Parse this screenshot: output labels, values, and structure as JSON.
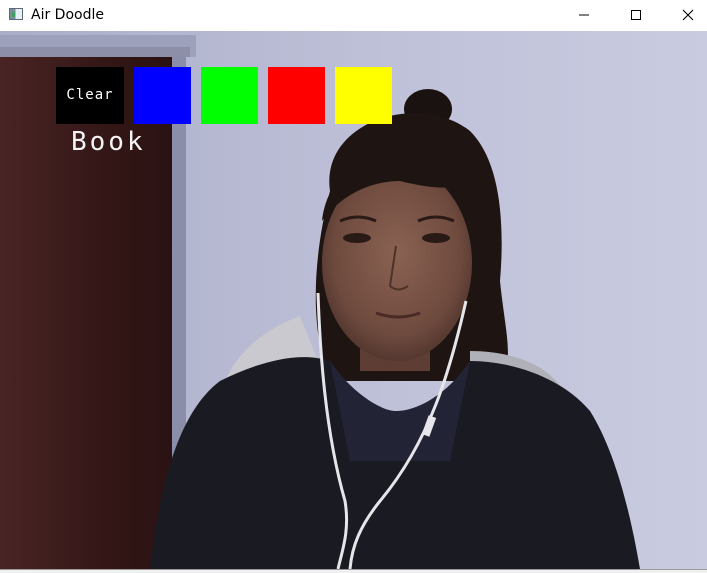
{
  "window": {
    "title": "Air Doodle",
    "icon": "app-window-icon"
  },
  "window_controls": {
    "minimize_icon": "minimize-icon",
    "maximize_icon": "maximize-icon",
    "close_icon": "close-icon"
  },
  "toolbar": {
    "clear_label": "Clear",
    "colors": [
      {
        "name": "blue",
        "hex": "#0000ff"
      },
      {
        "name": "green",
        "hex": "#00ff00"
      },
      {
        "name": "red",
        "hex": "#ff0000"
      },
      {
        "name": "yellow",
        "hex": "#ffff00"
      }
    ]
  },
  "overlay": {
    "recognized_text": "Book"
  },
  "colors": {
    "clear_button_bg": "#000000",
    "wall": "#b6b9d2",
    "door": "#3a1a1a",
    "jacket": "#1a1a22"
  }
}
